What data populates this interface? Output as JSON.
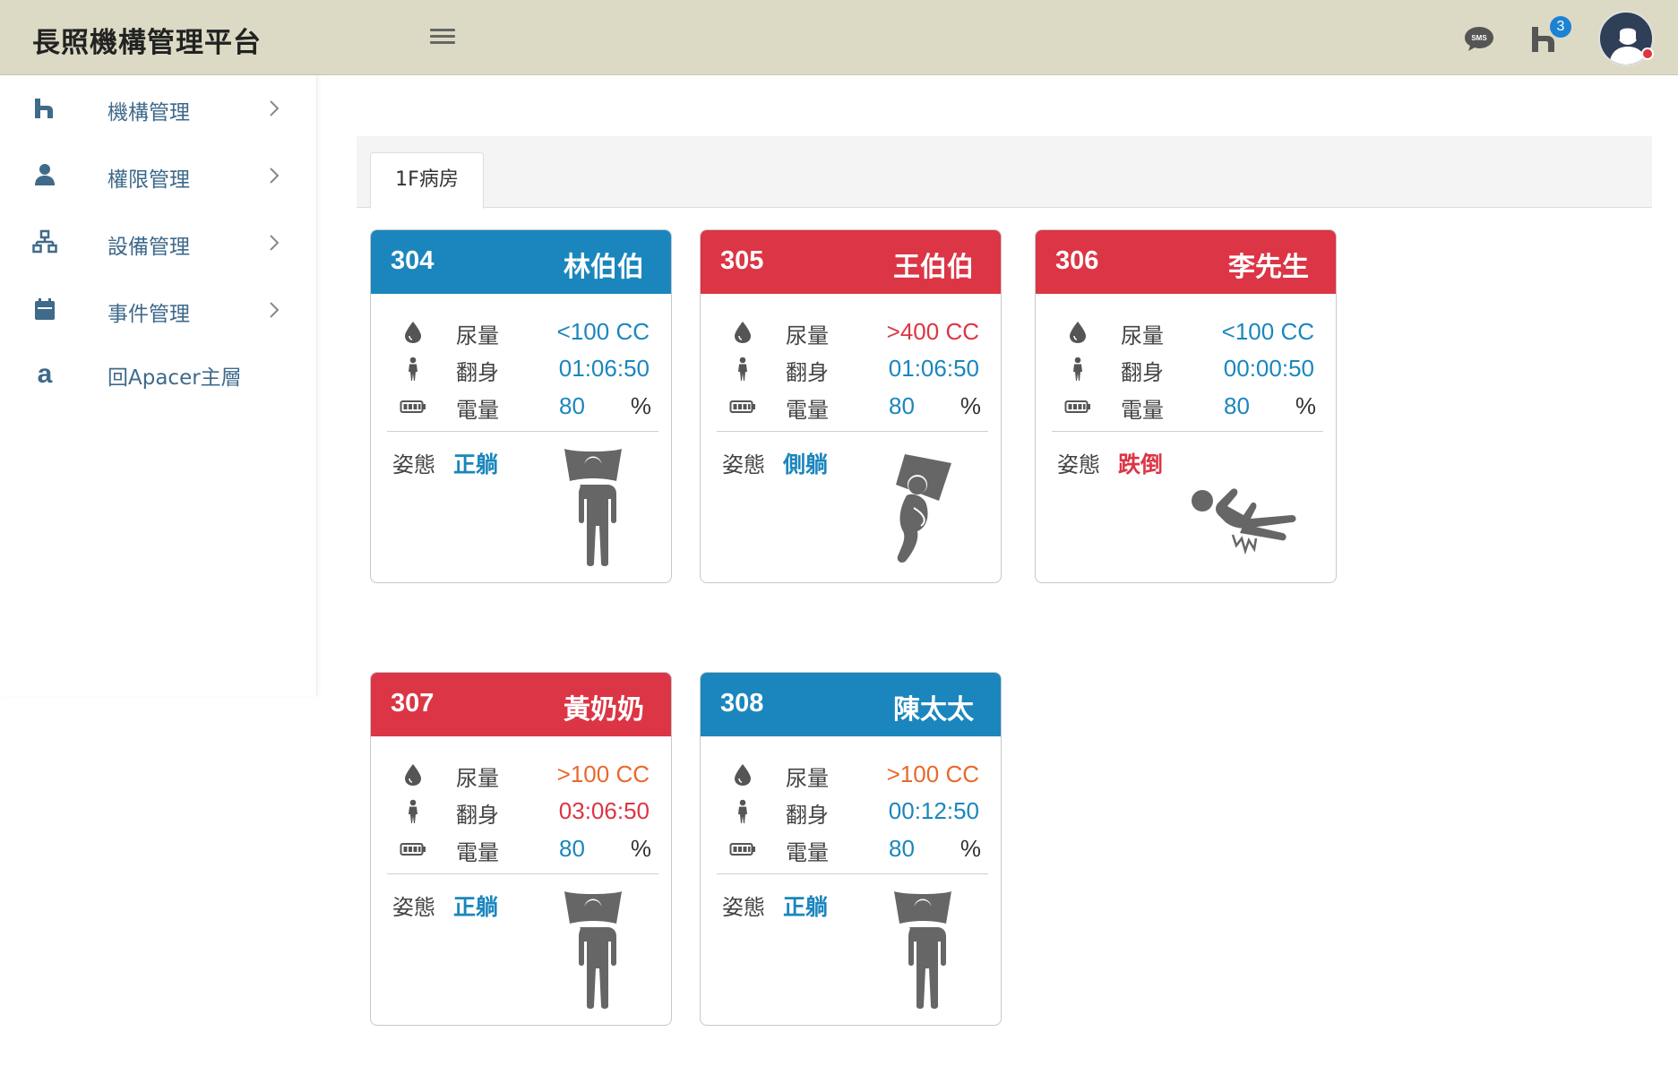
{
  "app": {
    "title": "長照機構管理平台"
  },
  "header": {
    "notification_count": "3"
  },
  "sidebar": {
    "items": [
      {
        "label": "機構管理",
        "icon": "home-icon"
      },
      {
        "label": "權限管理",
        "icon": "user-icon"
      },
      {
        "label": "設備管理",
        "icon": "network-icon"
      },
      {
        "label": "事件管理",
        "icon": "calendar-icon"
      },
      {
        "label": "回Apacer主層",
        "icon": "apacer-icon"
      }
    ]
  },
  "tabs": [
    {
      "label": "1F病房",
      "active": true
    }
  ],
  "labels": {
    "urine": "尿量",
    "turn": "翻身",
    "battery": "電量",
    "posture": "姿態",
    "percent": "%"
  },
  "cards": [
    {
      "room": "304",
      "name": "林伯伯",
      "header_color": "blue",
      "urine": "<100 CC",
      "urine_color": "blue",
      "turn": "01:06:50",
      "turn_color": "blue",
      "battery": "80",
      "posture": "正躺",
      "posture_color": "blue",
      "posture_icon": "lying-supine-icon"
    },
    {
      "room": "305",
      "name": "王伯伯",
      "header_color": "red",
      "urine": ">400 CC",
      "urine_color": "red",
      "turn": "01:06:50",
      "turn_color": "blue",
      "battery": "80",
      "posture": "側躺",
      "posture_color": "blue",
      "posture_icon": "lying-side-icon"
    },
    {
      "room": "306",
      "name": "李先生",
      "header_color": "red",
      "urine": "<100 CC",
      "urine_color": "blue",
      "turn": "00:00:50",
      "turn_color": "blue",
      "battery": "80",
      "posture": "跌倒",
      "posture_color": "red",
      "posture_icon": "fall-icon"
    },
    {
      "room": "307",
      "name": "黃奶奶",
      "header_color": "red",
      "urine": ">100 CC",
      "urine_color": "orange",
      "turn": "03:06:50",
      "turn_color": "red",
      "battery": "80",
      "posture": "正躺",
      "posture_color": "blue",
      "posture_icon": "lying-supine-icon"
    },
    {
      "room": "308",
      "name": "陳太太",
      "header_color": "blue",
      "urine": ">100 CC",
      "urine_color": "orange",
      "turn": "00:12:50",
      "turn_color": "blue",
      "battery": "80",
      "posture": "正躺",
      "posture_color": "blue",
      "posture_icon": "lying-supine-icon"
    }
  ],
  "colors": {
    "header_bg": "#dcdac4",
    "blue": "#1b86bd",
    "red": "#dc3545",
    "orange": "#e8692c",
    "icon_gray": "#555555"
  }
}
